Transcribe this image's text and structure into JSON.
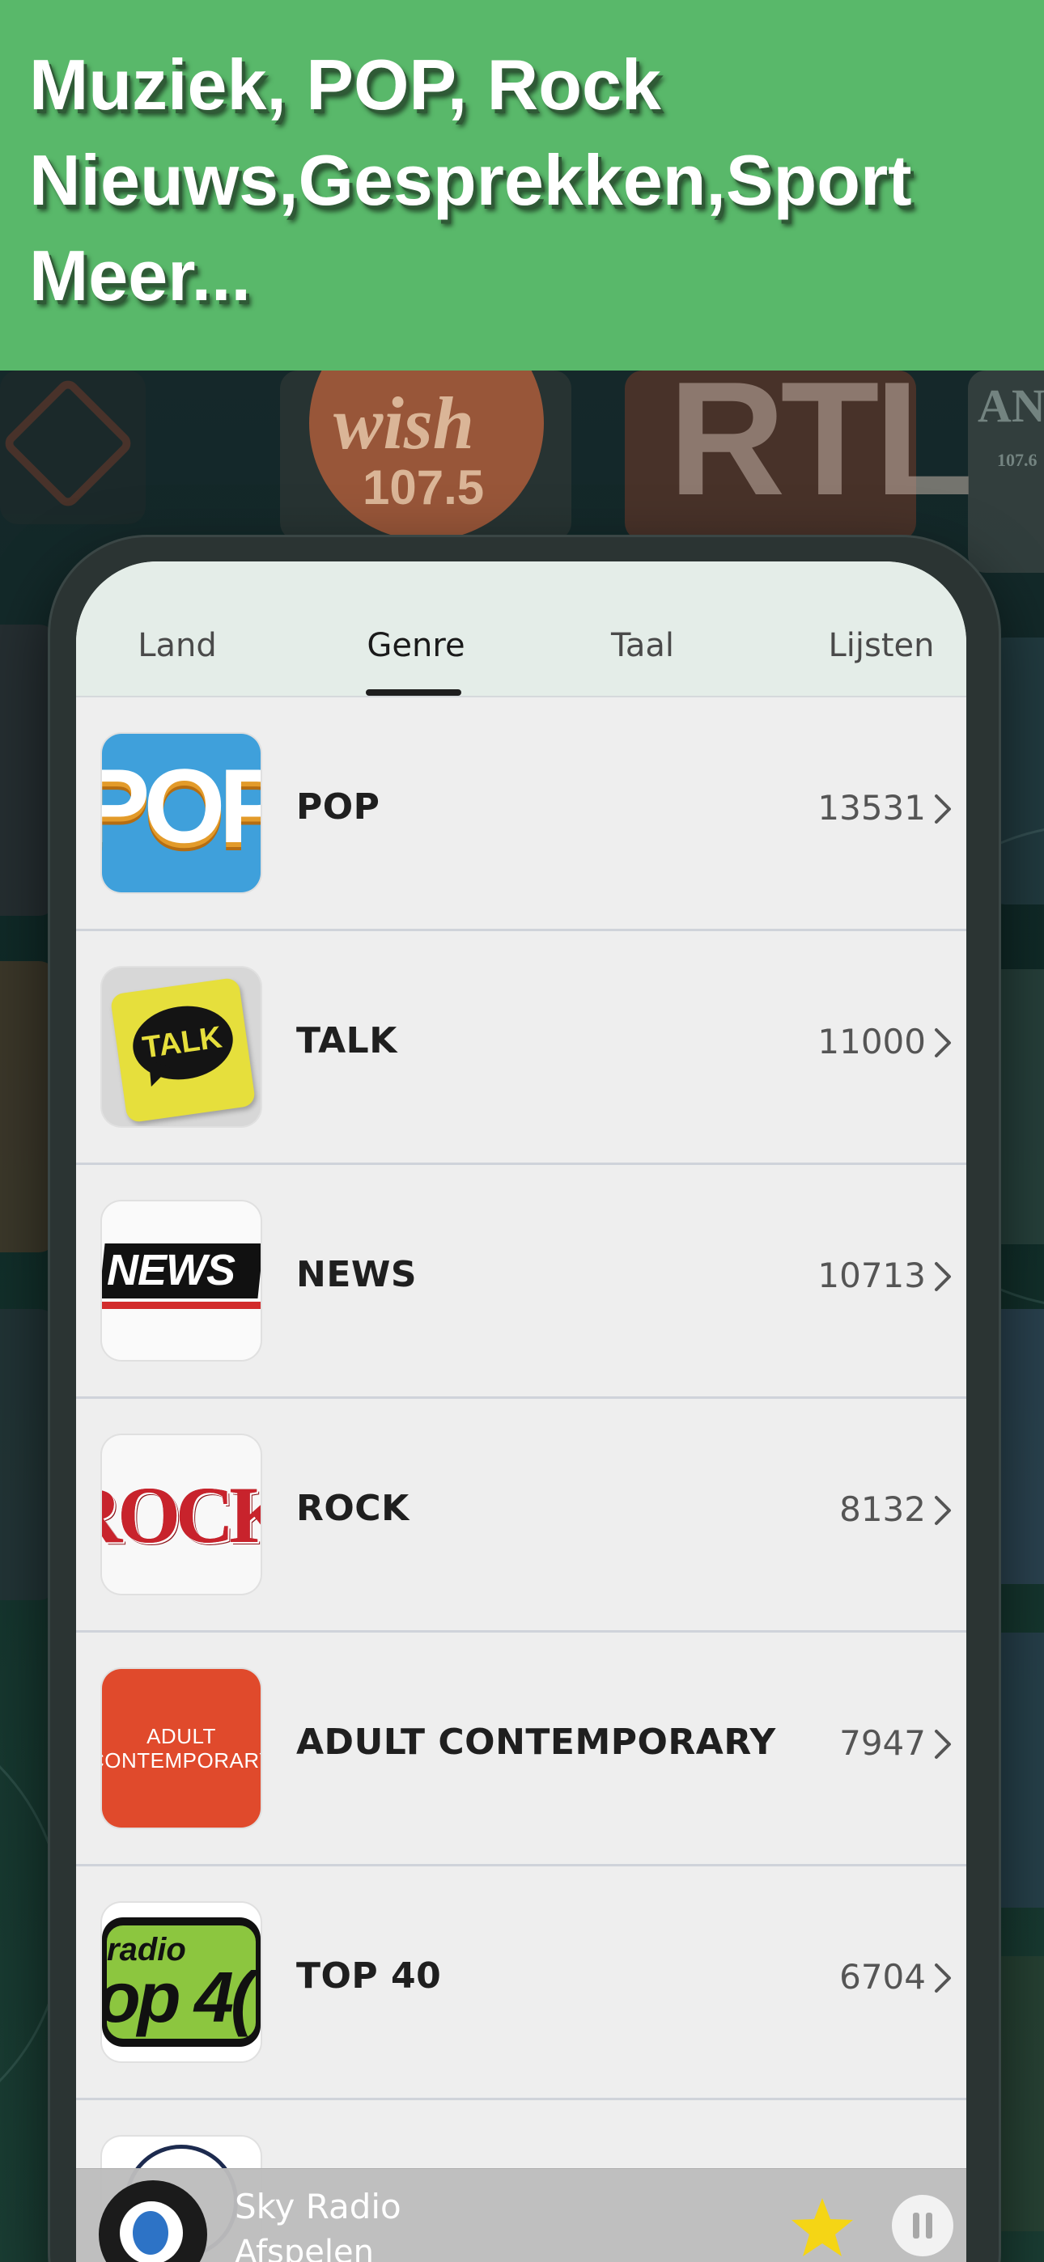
{
  "banner": {
    "line1": "Muziek, POP, Rock",
    "line2": "Nieuws,Gesprekken,Sport",
    "line3": "Meer..."
  },
  "background": {
    "logos": [
      "wish",
      "107.5",
      "RTL",
      "AN",
      "107.6"
    ]
  },
  "tabs": [
    {
      "label": "Land",
      "active": false
    },
    {
      "label": "Genre",
      "active": true
    },
    {
      "label": "Taal",
      "active": false
    },
    {
      "label": "Lijsten",
      "active": false
    }
  ],
  "genres": [
    {
      "name": "POP",
      "count": "13531",
      "thumb_text": "POP"
    },
    {
      "name": "TALK",
      "count": "11000",
      "thumb_text": "TALK"
    },
    {
      "name": "NEWS",
      "count": "10713",
      "thumb_text": "NEWS"
    },
    {
      "name": "ROCK",
      "count": "8132",
      "thumb_text": "ROCK"
    },
    {
      "name": "ADULT CONTEMPORARY",
      "count": "7947",
      "thumb_text_1": "ADULT",
      "thumb_text_2": "CONTEMPORARY"
    },
    {
      "name": "TOP 40",
      "count": "6704",
      "thumb_text_1": "radio",
      "thumb_text_2": "op 4("
    }
  ],
  "player": {
    "title": "Sky Radio",
    "subtitle": "Afspelen"
  },
  "colors": {
    "banner": "#59b86a",
    "star": "#f5d515",
    "list_background": "#eeeeee",
    "tabbar": "#e4ede8"
  },
  "icons": [
    "chevron-right-icon",
    "star-icon",
    "pause-icon"
  ]
}
